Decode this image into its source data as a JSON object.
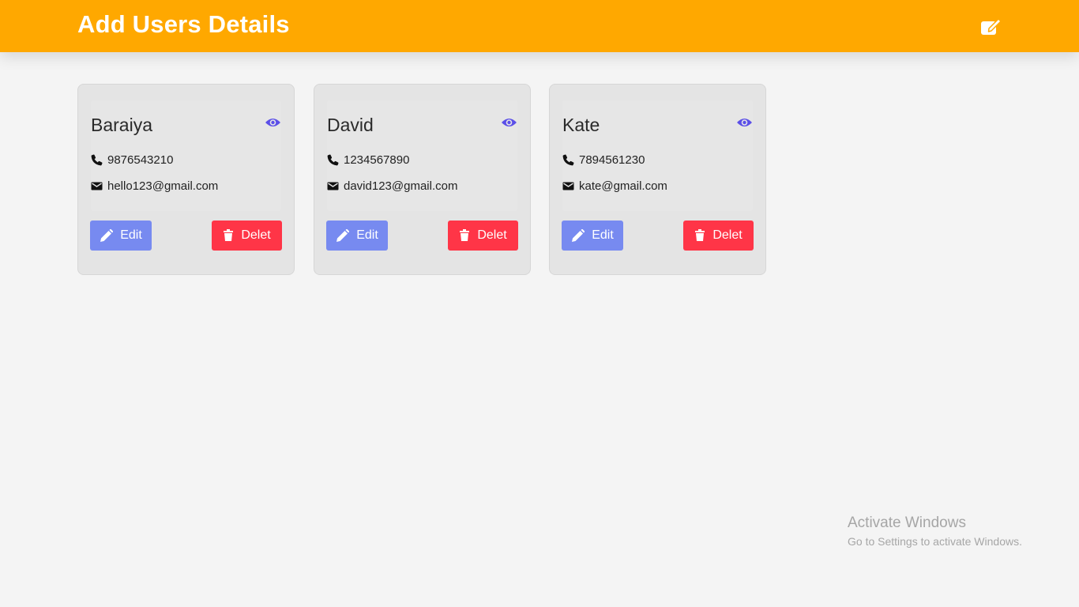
{
  "header": {
    "title": "Add Users Details",
    "add_icon": "edit-square-icon",
    "background": "#ffa800"
  },
  "users": [
    {
      "name": "Baraiya",
      "phone": "9876543210",
      "email": "hello123@gmail.com"
    },
    {
      "name": "David",
      "phone": "1234567890",
      "email": "david123@gmail.com"
    },
    {
      "name": "Kate",
      "phone": "7894561230",
      "email": "kate@gmail.com"
    }
  ],
  "card_actions": {
    "edit_label": "Edit",
    "delete_label": "Delet",
    "view_icon": "eye-icon",
    "edit_icon": "pencil-icon",
    "delete_icon": "trash-icon",
    "phone_icon": "phone-icon",
    "email_icon": "envelope-icon"
  },
  "colors": {
    "edit_button": "#778af0",
    "delete_button": "#ff3547",
    "eye_icon": "#5b4fe8"
  },
  "watermark": {
    "title": "Activate Windows",
    "subtitle": "Go to Settings to activate Windows."
  }
}
